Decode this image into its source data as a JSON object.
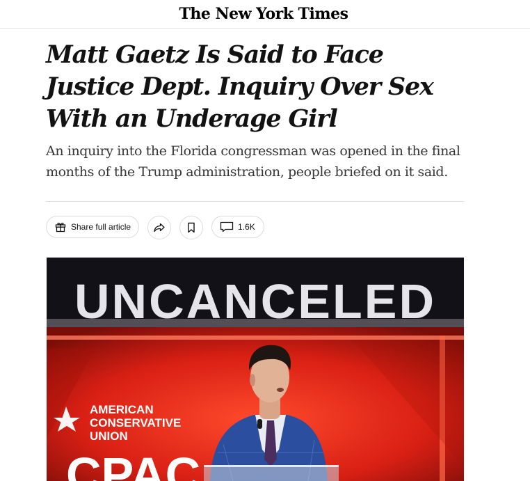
{
  "masthead": {
    "logo_text": "The New York Times"
  },
  "article": {
    "headline": "Matt Gaetz Is Said to Face Justice Dept. Inquiry Over Sex With an Underage Girl",
    "summary": "An inquiry into the Florida congressman was opened in the final months of the Trump administration, people briefed on it said."
  },
  "toolbar": {
    "share_full_article_label": "Share full article",
    "share_icon": "share-arrow-icon",
    "save_icon": "bookmark-icon",
    "comments_icon": "comment-icon",
    "comments_count": "1.6K"
  },
  "photo": {
    "banner_text": "UNCANCELED",
    "org_text_line1": "AMERICAN",
    "org_text_line2": "CONSERVATIVE",
    "org_text_line3": "UNION",
    "event_text": "CPAC",
    "colors": {
      "stage_red": "#e0261b",
      "suit_blue": "#2b4f9e",
      "background_dark": "#101014"
    }
  }
}
